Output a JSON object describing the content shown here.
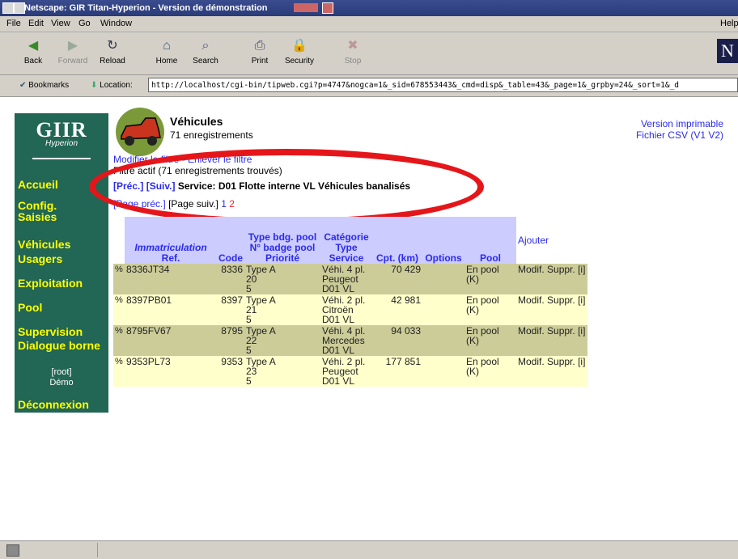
{
  "window": {
    "title": "Netscape: GIR Titan-Hyperion - Version de démonstration"
  },
  "menu": [
    "File",
    "Edit",
    "View",
    "Go",
    "Window"
  ],
  "menu_help": "Help",
  "toolbar": [
    {
      "label": "Back",
      "icon": "back-arrow-icon",
      "glyph": "◀"
    },
    {
      "label": "Forward",
      "icon": "forward-arrow-icon",
      "glyph": "▶"
    },
    {
      "label": "Reload",
      "icon": "reload-icon",
      "glyph": "↻"
    },
    {
      "label": "Home",
      "icon": "home-icon",
      "glyph": "⌂"
    },
    {
      "label": "Search",
      "icon": "search-icon",
      "glyph": "⌕"
    },
    {
      "label": "Print",
      "icon": "print-icon",
      "glyph": "⎙"
    },
    {
      "label": "Security",
      "icon": "security-icon",
      "glyph": "🔒"
    },
    {
      "label": "Stop",
      "icon": "stop-icon",
      "glyph": "✖"
    }
  ],
  "location": {
    "bookmarks_label": "Bookmarks",
    "location_label": "Location:",
    "url": "http://localhost/cgi-bin/tipweb.cgi?p=4747&nogca=1&_sid=678553443&_cmd=disp&_table=43&_page=1&_grpby=24&_sort=1&_d"
  },
  "sidebar": {
    "logo_text": "GIIR",
    "logo_sub": "Hyperion",
    "items": [
      "Accueil",
      "Config.",
      "Saisies",
      "Véhicules",
      "Usagers",
      "Exploitation",
      "Pool",
      "Supervision",
      "Dialogue borne"
    ],
    "user_role": "[root]",
    "user_name": "Démo",
    "logout": "Déconnexion"
  },
  "page": {
    "title": "Véhicules",
    "count": "71 enregistrements",
    "print_link": "Version imprimable",
    "csv_link": "Fichier CSV (V1 V2)",
    "filter_links": "Modifier le filtre - Enlever le filtre",
    "filter_info": "Filtre actif (71 enregistrements trouvés)",
    "prev": "[Préc.]",
    "next": "[Suiv.]",
    "service": "Service: D01 Flotte interne VL Véhicules banalisés",
    "page_prev": "[Page préc.]",
    "page_next": "[Page suiv.]",
    "page_1": "1",
    "page_2": "2"
  },
  "table": {
    "headers": {
      "immat": "Immatriculation",
      "ref": "Ref.",
      "code": "Code",
      "type_bdg": "Type bdg. pool",
      "badge": "N° badge pool",
      "priorite": "Priorité",
      "categorie": "Catégorie",
      "type": "Type",
      "service": "Service",
      "cpt": "Cpt. (km)",
      "options": "Options",
      "pool": "Pool",
      "ajouter": "Ajouter"
    },
    "rows": [
      {
        "pct": "%",
        "immat": "8336JT34",
        "code": "8336",
        "type_bdg": "Type A",
        "badge": "20",
        "prio": "5",
        "cat": "Véhi. 4 pl.",
        "type": "Peugeot",
        "service": "D01 VL",
        "cpt": "70 429",
        "options": "",
        "pool": "En pool (K)",
        "modif": "Modif.",
        "suppr": "Suppr.",
        "info": "[i]"
      },
      {
        "pct": "%",
        "immat": "8397PB01",
        "code": "8397",
        "type_bdg": "Type A",
        "badge": "21",
        "prio": "5",
        "cat": "Véhi. 2 pl.",
        "type": "Citroën",
        "service": "D01 VL",
        "cpt": "42 981",
        "options": "",
        "pool": "En pool (K)",
        "modif": "Modif.",
        "suppr": "Suppr.",
        "info": "[i]"
      },
      {
        "pct": "%",
        "immat": "8795FV67",
        "code": "8795",
        "type_bdg": "Type A",
        "badge": "22",
        "prio": "5",
        "cat": "Véhi. 4 pl.",
        "type": "Mercedes",
        "service": "D01 VL",
        "cpt": "94 033",
        "options": "",
        "pool": "En pool (K)",
        "modif": "Modif.",
        "suppr": "Suppr.",
        "info": "[i]"
      },
      {
        "pct": "%",
        "immat": "9353PL73",
        "code": "9353",
        "type_bdg": "Type A",
        "badge": "23",
        "prio": "5",
        "cat": "Véhi. 2 pl.",
        "type": "Peugeot",
        "service": "D01 VL",
        "cpt": "177 851",
        "options": "",
        "pool": "En pool (K)",
        "modif": "Modif.",
        "suppr": "Suppr.",
        "info": "[i]"
      }
    ]
  },
  "colors": {
    "sidebar": "#226655",
    "nav_text": "#ffff00",
    "link": "#2a2af0",
    "header_bg": "#ccccff",
    "row_odd": "#cccc99",
    "row_even": "#ffffcc",
    "highlight_oval": "#e5161a"
  }
}
